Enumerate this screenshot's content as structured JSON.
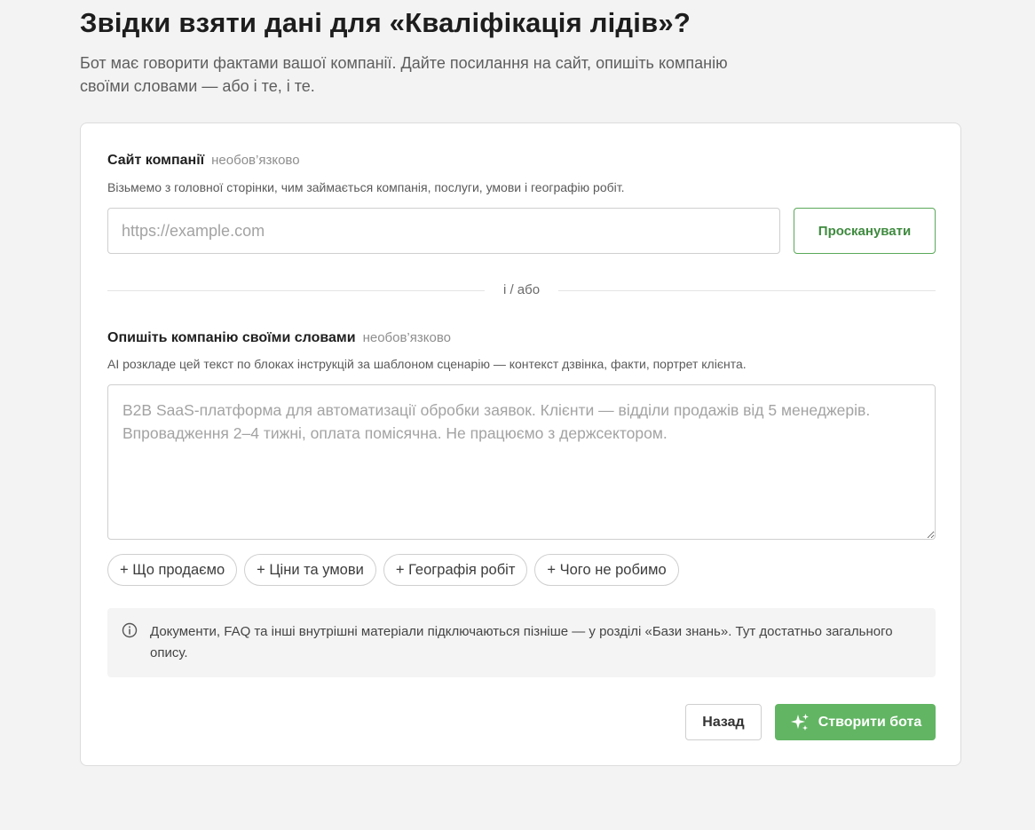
{
  "header": {
    "title": "Звідки взяти дані для «Кваліфікація лідів»?",
    "subtitle": "Бот має говорити фактами вашої компанії. Дайте посилання на сайт, опишіть компанію своїми словами — або і те, і те."
  },
  "website": {
    "label": "Сайт компанії",
    "optional": "необов’язково",
    "hint": "Візьмемо з головної сторінки, чим займається компанія, послуги, умови і географію робіт.",
    "placeholder": "https://example.com",
    "value": "",
    "scan_label": "Просканувати"
  },
  "divider": {
    "text": "і / або"
  },
  "description": {
    "label": "Опишіть компанію своїми словами",
    "optional": "необов’язково",
    "hint": "AI розкладе цей текст по блоках інструкцій за шаблоном сценарію — контекст дзвінка, факти, портрет клієнта.",
    "placeholder": "B2B SaaS-платформа для автоматизації обробки заявок. Клієнти — відділи продажів від 5 менеджерів. Впровадження 2–4 тижні, оплата помісячна. Не працюємо з держсектором.",
    "value": ""
  },
  "chips": [
    {
      "label": "+ Що продаємо"
    },
    {
      "label": "+ Ціни та умови"
    },
    {
      "label": "+ Географія робіт"
    },
    {
      "label": "+ Чого не робимо"
    }
  ],
  "info": {
    "icon": "info-icon",
    "text": "Документи, FAQ та інші внутрішні матеріали підключаються пізніше — у розділі «Бази знань». Тут достатньо загального опису."
  },
  "actions": {
    "back_label": "Назад",
    "create_label": "Створити бота",
    "create_icon": "sparkles-icon"
  },
  "colors": {
    "accent": "#62b563",
    "accent_text": "#3f8a3f",
    "background": "#f3f3f3"
  }
}
